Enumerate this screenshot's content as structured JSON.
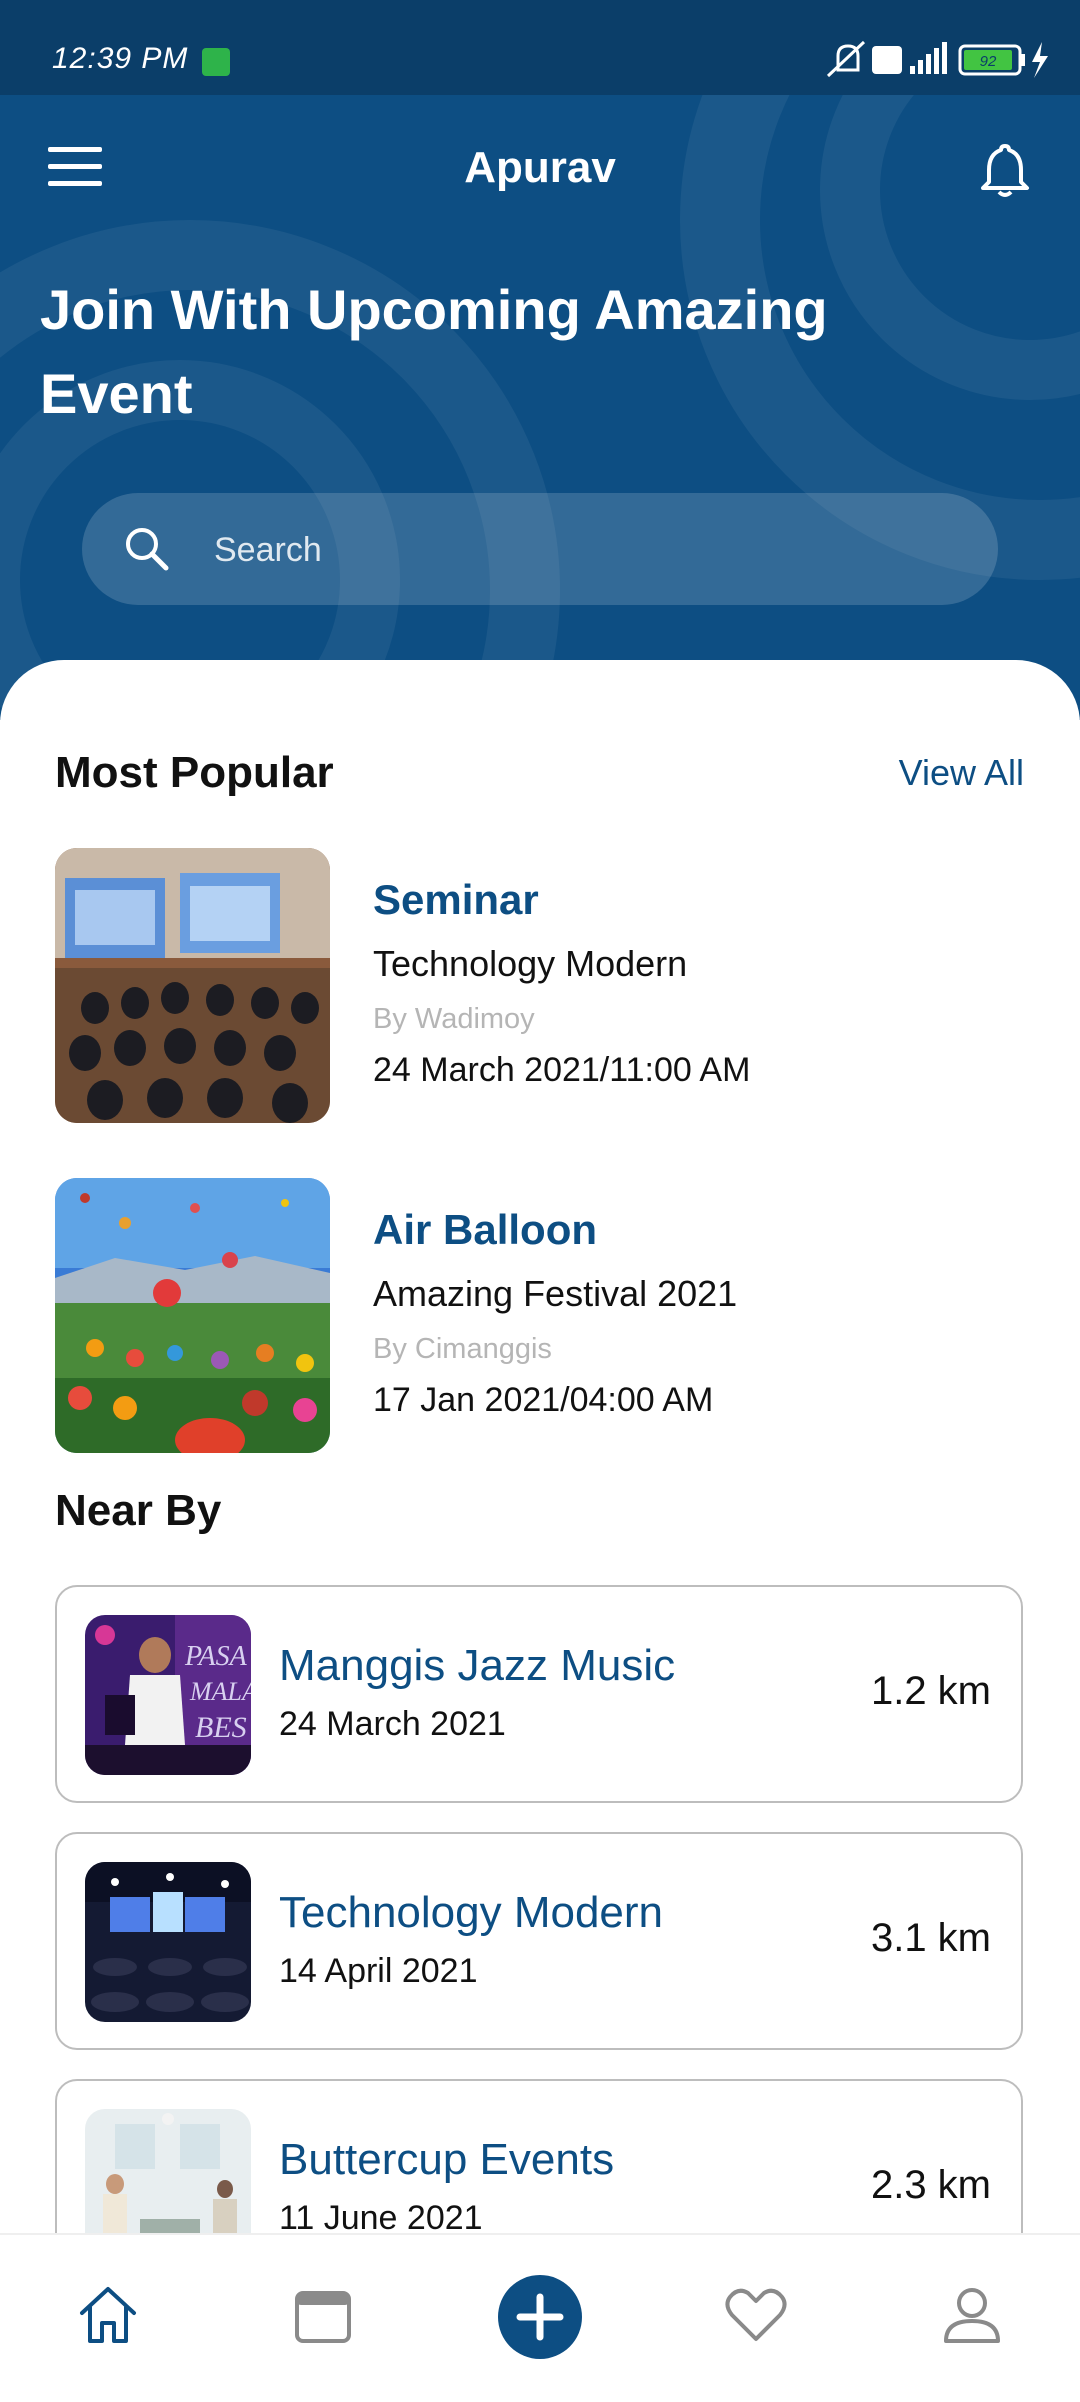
{
  "status_bar": {
    "time": "12:39 PM",
    "battery": "92"
  },
  "header": {
    "title": "Apurav"
  },
  "hero": {
    "headline": "Join With Upcoming Amazing Event"
  },
  "search": {
    "placeholder": "Search"
  },
  "most_popular": {
    "title": "Most Popular",
    "view_all": "View All",
    "items": [
      {
        "title": "Seminar",
        "subtitle": "Technology Modern",
        "by": "By Wadimoy",
        "date": "24 March 2021/11:00 AM",
        "image": "seminar-photo"
      },
      {
        "title": "Air Balloon",
        "subtitle": "Amazing Festival 2021",
        "by": "By Cimanggis",
        "date": "17 Jan 2021/04:00 AM",
        "image": "balloon-festival-photo"
      }
    ]
  },
  "near_by": {
    "title": "Near By",
    "items": [
      {
        "title": "Manggis Jazz Music",
        "date": "24 March 2021",
        "distance": "1.2 km",
        "image": "jazz-concert-photo"
      },
      {
        "title": "Technology Modern",
        "date": "14 April 2021",
        "distance": "3.1 km",
        "image": "conference-hall-photo"
      },
      {
        "title": "Buttercup Events",
        "date": "11 June 2021",
        "distance": "2.3 km",
        "image": "event-venue-photo"
      }
    ]
  },
  "bottom_nav": {
    "items": [
      {
        "icon": "home-icon"
      },
      {
        "icon": "calendar-icon"
      },
      {
        "icon": "add-icon"
      },
      {
        "icon": "favorite-icon"
      },
      {
        "icon": "profile-icon"
      }
    ]
  },
  "colors": {
    "primary": "#0d4e83",
    "status_bar": "#0b3e69",
    "text": "#111111",
    "muted": "#b5b5b5"
  }
}
